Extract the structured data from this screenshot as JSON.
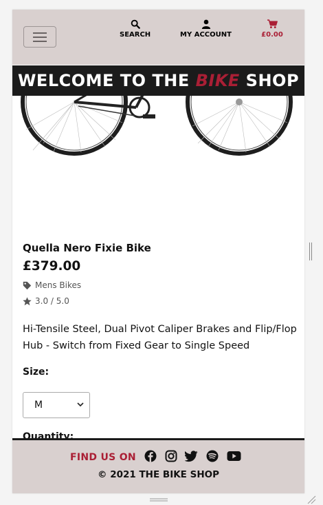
{
  "navbar": {
    "search_label": "SEARCH",
    "account_label": "MY ACCOUNT",
    "cart_label": "£0.00",
    "cart_color": "#aa1f35",
    "background": "#d9d0cf"
  },
  "banner": {
    "prefix": "WELCOME TO THE ",
    "accent": "BIKE",
    "suffix": " SHOP"
  },
  "product": {
    "name": "Quella Nero Fixie Bike",
    "price": "£379.00",
    "category": "Mens Bikes",
    "rating": "3.0 / 5.0",
    "description": "Hi-Tensile Steel, Dual Pivot Caliper Brakes and Flip/Flop Hub - Switch from Fixed Gear to Single Speed",
    "size_label": "Size:",
    "size_selected": "M",
    "quantity_label": "Quantity:"
  },
  "footer": {
    "find_us": "FIND US ON",
    "social": [
      "facebook-icon",
      "instagram-icon",
      "twitter-icon",
      "spotify-icon",
      "youtube-icon"
    ],
    "copyright": "© 2021 THE BIKE SHOP"
  },
  "colors": {
    "accent": "#aa1f35",
    "dark": "#1b1b1b",
    "panel": "#d9d0cf"
  }
}
